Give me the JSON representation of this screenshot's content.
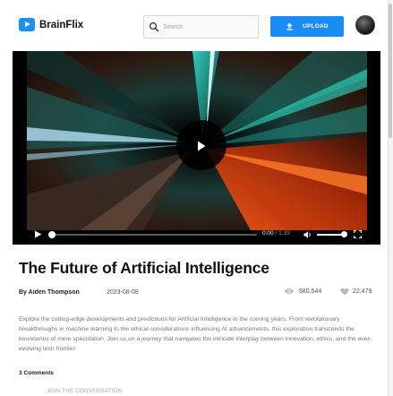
{
  "header": {
    "brand": "BrainFlix",
    "search": {
      "placeholder": "Search",
      "value": ""
    },
    "upload_label": "UPLOAD"
  },
  "player": {
    "current_time": "0:00",
    "duration": "1:39",
    "progress": 0,
    "volume": 1.0
  },
  "video": {
    "title": "The Future of Artificial Intelligence",
    "author": "By Aiden Thompson",
    "date": "2023-08-08",
    "views": "980,544",
    "likes": "22,479",
    "description": "Explore the cutting-edge developments and predictions for Artificial Intelligence in the coming years. From revolutionary breakthroughs in machine learning to the ethical considerations influencing AI advancements, this exploration transcends the boundaries of mere speculation. Join us on a journey that navigates the intricate interplay between innovation, ethics, and the ever-evolving tech frontier."
  },
  "comments": {
    "count_label": "3 Comments",
    "join_label": "JOIN THE CONVERSATION"
  },
  "colors": {
    "accent": "#1a8cf5",
    "text": "#111111",
    "muted": "#777777"
  },
  "icons": [
    "brainflix-logo-icon",
    "search-icon",
    "upload-icon",
    "play-icon",
    "volume-icon",
    "fullscreen-icon",
    "eye-icon",
    "heart-icon"
  ]
}
